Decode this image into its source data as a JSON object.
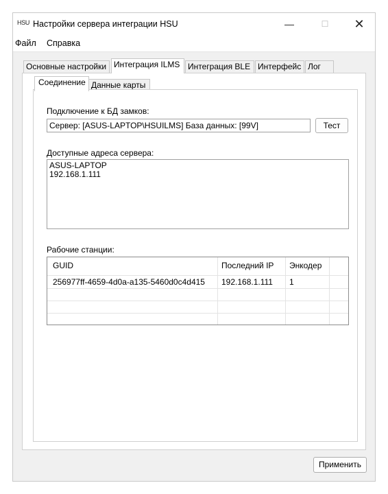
{
  "window": {
    "app_icon_text": "HSU",
    "title": "Настройки сервера интеграции HSU",
    "min_glyph": "—",
    "max_glyph": "☐",
    "close_glyph": "✕"
  },
  "menu": [
    "Файл",
    "Справка"
  ],
  "main_tabs": [
    {
      "label": "Основные настройки",
      "active": false
    },
    {
      "label": "Интеграция ILMS",
      "active": true
    },
    {
      "label": "Интеграция BLE",
      "active": false
    },
    {
      "label": "Интерфейс",
      "active": false
    },
    {
      "label": "Лог",
      "active": false
    }
  ],
  "sub_tabs": [
    {
      "label": "Соединение",
      "active": true
    },
    {
      "label": "Данные карты",
      "active": false
    }
  ],
  "connection": {
    "label": "Подключение к БД замков:",
    "value": "Сервер: [ASUS-LAPTOP\\HSUILMS] База данных: [99V]",
    "test_button": "Тест"
  },
  "addresses": {
    "label": "Доступные адреса сервера:",
    "items": [
      "ASUS-LAPTOP",
      "192.168.1.111"
    ]
  },
  "workstations": {
    "label": "Рабочие станции:",
    "columns": [
      "GUID",
      "Последний IP",
      "Энкодер"
    ],
    "rows": [
      [
        "256977ff-4659-4d0a-a135-5460d0c4d415",
        "192.168.1.111",
        "1"
      ]
    ]
  },
  "apply_button": "Применить"
}
